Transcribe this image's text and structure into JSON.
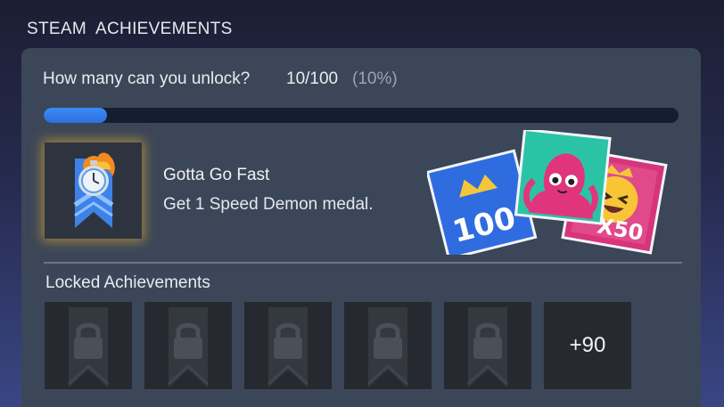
{
  "header": {
    "title": "STEAM  ACHIEVEMENTS"
  },
  "progress": {
    "question": "How many can you unlock?",
    "count": "10/100",
    "percent_label": "(10%)",
    "fraction": 0.1
  },
  "featured": {
    "icon": "stopwatch-ribbon-icon",
    "name": "Gotta Go Fast",
    "description": "Get 1 Speed Demon medal."
  },
  "promo": {
    "badge_100_text": "100",
    "badge_x50_text": "X50"
  },
  "locked": {
    "heading": "Locked Achievements",
    "tiles": [
      "locked-icon",
      "locked-icon",
      "locked-icon",
      "locked-icon",
      "locked-icon"
    ],
    "more_label": "+90"
  },
  "colors": {
    "accent": "#3d8bf5",
    "panel": "#3b4658",
    "track": "#141e30",
    "glow": "#f0b428"
  }
}
